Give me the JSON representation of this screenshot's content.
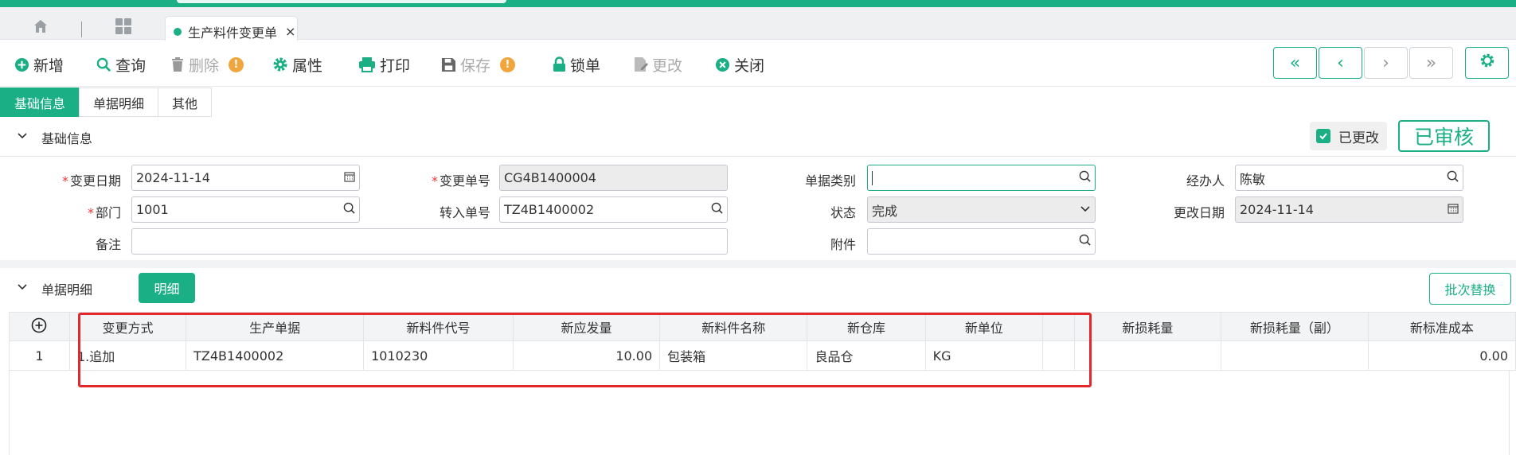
{
  "colors": {
    "accent": "#1aaf85",
    "warning": "#f0a63c",
    "highlight": "#e3272b"
  },
  "topbar": {
    "home_icon": "home-icon",
    "apps_icon": "apps-grid-icon",
    "tab_label": "生产料件变更单",
    "tab_close": "×"
  },
  "toolbar": {
    "add": "新增",
    "query": "查询",
    "delete": "删除",
    "properties": "属性",
    "print": "打印",
    "save": "保存",
    "lock": "锁单",
    "modify": "更改",
    "close": "关闭",
    "nav": {
      "first": "«",
      "prev": "‹",
      "next": "›",
      "last": "»"
    }
  },
  "subtabs": [
    "基础信息",
    "单据明细",
    "其他"
  ],
  "basic": {
    "section_title": "基础信息",
    "changed_label": "已更改",
    "approved_label": "已审核",
    "change_date_label": "变更日期",
    "change_date": "2024-11-14",
    "change_no_label": "变更单号",
    "change_no": "CG4B1400004",
    "doc_type_label": "单据类别",
    "doc_type": "",
    "handler_label": "经办人",
    "handler": "陈敏",
    "dept_label": "部门",
    "dept": "1001",
    "transfer_no_label": "转入单号",
    "transfer_no": "TZ4B1400002",
    "status_label": "状态",
    "status": "完成",
    "modify_date_label": "更改日期",
    "modify_date": "2024-11-14",
    "remark_label": "备注",
    "remark": "",
    "attachment_label": "附件",
    "attachment": ""
  },
  "detail": {
    "section_title": "单据明细",
    "detail_button": "明细",
    "batch_replace": "批次替换",
    "columns": [
      "变更方式",
      "生产单据",
      "新料件代号",
      "新应发量",
      "新料件名称",
      "新仓库",
      "新单位",
      "",
      "新损耗量",
      "新损耗量（副）",
      "新标准成本"
    ],
    "rows": [
      {
        "no": "1",
        "cells": [
          "1.追加",
          "TZ4B1400002",
          "1010230",
          "10.00",
          "包装箱",
          "良品仓",
          "KG",
          "",
          "",
          "",
          "0.00"
        ]
      }
    ]
  }
}
